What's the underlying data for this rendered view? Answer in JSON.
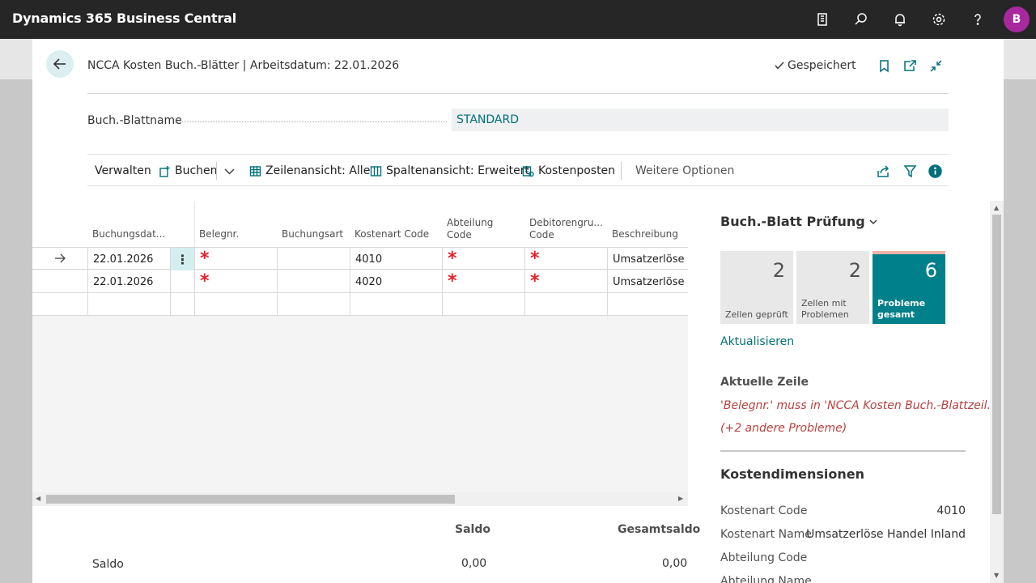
{
  "app": {
    "title": "Dynamics 365 Business Central",
    "user_initial": "B"
  },
  "header": {
    "title": "NCCA Kosten Buch.-Blätter | Arbeitsdatum: 22.01.2026",
    "saved": "Gespeichert"
  },
  "field": {
    "label": "Buch.-Blattname",
    "value": "STANDARD"
  },
  "actions": {
    "manage": "Verwalten",
    "post": "Buchen",
    "row_view": "Zeilenansicht: Alle",
    "column_view": "Spaltenansicht: Erweitert",
    "cost_entries": "Kostenposten",
    "more": "Weitere Optionen"
  },
  "grid": {
    "columns": {
      "posting_date": "Buchungsdat...",
      "doc_no": "Belegnr.",
      "posting_type": "Buchungsart",
      "cost_type_code": "Kostenart Code",
      "department_l1": "Abteilung",
      "department_l2": "Code",
      "customer_group_l1": "Debitorengru...",
      "customer_group_l2": "Code",
      "description": "Beschreibung"
    },
    "rows": [
      {
        "date": "22.01.2026",
        "cost_type": "4010",
        "description": "Umsatzerlöse Handel Inland",
        "req": "*"
      },
      {
        "date": "22.01.2026",
        "cost_type": "4020",
        "description": "Umsatzerlöse Handel Inland",
        "req": "*"
      }
    ]
  },
  "totals": {
    "saldo_header": "Saldo",
    "total_header": "Gesamtsaldo",
    "row_label": "Saldo",
    "saldo": "0,00",
    "total": "0,00"
  },
  "factbox": {
    "title": "Buch.-Blatt Prüfung",
    "tiles": [
      {
        "value": "2",
        "label_1": "Zellen geprüft",
        "label_2": ""
      },
      {
        "value": "2",
        "label_1": "Zellen mit",
        "label_2": "Problemen"
      },
      {
        "value": "6",
        "label_1": "Probleme",
        "label_2": "gesamt"
      }
    ],
    "refresh": "Aktualisieren",
    "current_line": "Aktuelle Zeile",
    "error_1": "'Belegnr.' muss in 'NCCA Kosten Buch.-Blattzeil...",
    "error_2": "(+2 andere Probleme)",
    "dimensions_title": "Kostendimensionen",
    "dims": [
      {
        "label": "Kostenart Code",
        "value": "4010"
      },
      {
        "label": "Kostenart Name",
        "value": "Umsatzerlöse Handel Inland"
      },
      {
        "label": "Abteilung Code",
        "value": ""
      },
      {
        "label": "Abteilung Name",
        "value": ""
      }
    ]
  },
  "colors": {
    "accent": "#00707a",
    "alert_tile": "#00808a",
    "error": "#b8413e",
    "required": "#e8202a",
    "topbar": "#262626"
  }
}
